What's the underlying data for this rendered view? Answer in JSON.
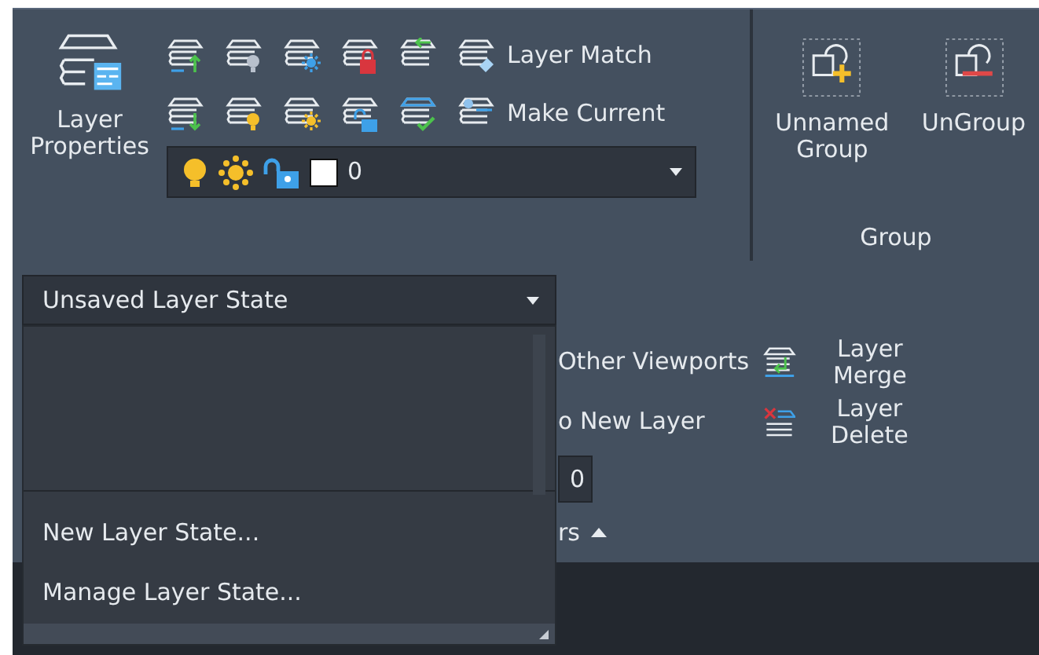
{
  "layers_panel": {
    "properties_button": {
      "label": "Layer Properties"
    },
    "labeled_tools": [
      {
        "label": "Layer Match"
      },
      {
        "label": "Make Current"
      }
    ],
    "layer_combo": {
      "value": "0",
      "on": true,
      "frozen": false,
      "locked": false,
      "color": "#ffffff"
    },
    "layer_state_combo": {
      "value": "Unsaved Layer State",
      "expanded": true
    },
    "layer_state_menu": [
      {
        "label": "New Layer State..."
      },
      {
        "label": "Manage Layer State..."
      }
    ],
    "side_tools": [
      {
        "label": "Other Viewports"
      },
      {
        "label": "o New Layer"
      }
    ],
    "right_tools": [
      {
        "label": "Layer Merge",
        "kind": "merge"
      },
      {
        "label": "Layer Delete",
        "kind": "delete"
      }
    ],
    "partial_field": {
      "value": "0"
    },
    "panel_title": "rs"
  },
  "group_panel": {
    "buttons": [
      {
        "label": "Unnamed Group",
        "kind": "add"
      },
      {
        "label": "UnGroup",
        "kind": "remove"
      }
    ],
    "title": "Group"
  }
}
